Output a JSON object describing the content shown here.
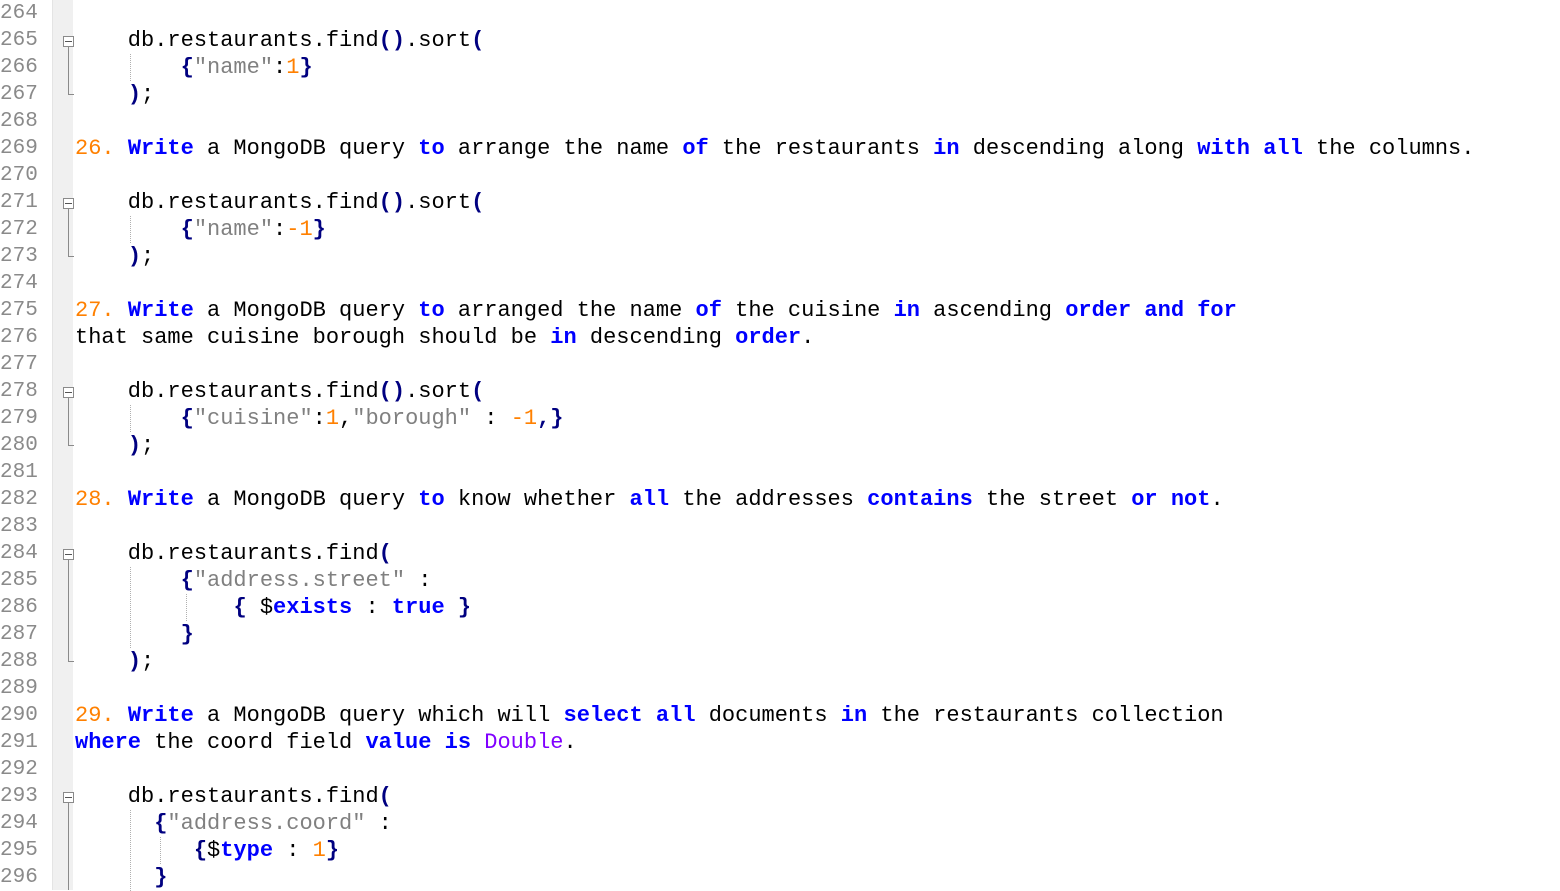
{
  "editor": {
    "line_numbers": [
      "264",
      "265",
      "266",
      "267",
      "268",
      "269",
      "270",
      "271",
      "272",
      "273",
      "274",
      "275",
      "276",
      "277",
      "278",
      "279",
      "280",
      "281",
      "282",
      "283",
      "284",
      "285",
      "286",
      "287",
      "288",
      "289",
      "290",
      "291",
      "292",
      "293",
      "294",
      "295",
      "296"
    ],
    "lines": [
      [],
      [
        {
          "t": "    db.restaurants.find",
          "c": "txt"
        },
        {
          "t": "()",
          "c": "op"
        },
        {
          "t": ".sort",
          "c": "txt"
        },
        {
          "t": "(",
          "c": "op"
        }
      ],
      [
        {
          "t": "        ",
          "c": "txt"
        },
        {
          "t": "{",
          "c": "op"
        },
        {
          "t": "\"name\"",
          "c": "str"
        },
        {
          "t": ":",
          "c": "txt"
        },
        {
          "t": "1",
          "c": "num"
        },
        {
          "t": "}",
          "c": "op"
        }
      ],
      [
        {
          "t": "    ",
          "c": "txt"
        },
        {
          "t": ")",
          "c": "op"
        },
        {
          "t": ";",
          "c": "txt"
        }
      ],
      [],
      [
        {
          "t": "26.",
          "c": "num"
        },
        {
          "t": " ",
          "c": "txt"
        },
        {
          "t": "Write",
          "c": "kw"
        },
        {
          "t": " a MongoDB query ",
          "c": "txt"
        },
        {
          "t": "to",
          "c": "kw"
        },
        {
          "t": " arrange the name ",
          "c": "txt"
        },
        {
          "t": "of",
          "c": "kw"
        },
        {
          "t": " the restaurants ",
          "c": "txt"
        },
        {
          "t": "in",
          "c": "kw"
        },
        {
          "t": " descending along ",
          "c": "txt"
        },
        {
          "t": "with",
          "c": "kw"
        },
        {
          "t": " ",
          "c": "txt"
        },
        {
          "t": "all",
          "c": "kw"
        },
        {
          "t": " the columns.",
          "c": "txt"
        }
      ],
      [],
      [
        {
          "t": "    db.restaurants.find",
          "c": "txt"
        },
        {
          "t": "()",
          "c": "op"
        },
        {
          "t": ".sort",
          "c": "txt"
        },
        {
          "t": "(",
          "c": "op"
        }
      ],
      [
        {
          "t": "        ",
          "c": "txt"
        },
        {
          "t": "{",
          "c": "op"
        },
        {
          "t": "\"name\"",
          "c": "str"
        },
        {
          "t": ":",
          "c": "txt"
        },
        {
          "t": "-1",
          "c": "num"
        },
        {
          "t": "}",
          "c": "op"
        }
      ],
      [
        {
          "t": "    ",
          "c": "txt"
        },
        {
          "t": ")",
          "c": "op"
        },
        {
          "t": ";",
          "c": "txt"
        }
      ],
      [],
      [
        {
          "t": "27.",
          "c": "num"
        },
        {
          "t": " ",
          "c": "txt"
        },
        {
          "t": "Write",
          "c": "kw"
        },
        {
          "t": " a MongoDB query ",
          "c": "txt"
        },
        {
          "t": "to",
          "c": "kw"
        },
        {
          "t": " arranged the name ",
          "c": "txt"
        },
        {
          "t": "of",
          "c": "kw"
        },
        {
          "t": " the cuisine ",
          "c": "txt"
        },
        {
          "t": "in",
          "c": "kw"
        },
        {
          "t": " ascending ",
          "c": "txt"
        },
        {
          "t": "order",
          "c": "kw"
        },
        {
          "t": " ",
          "c": "txt"
        },
        {
          "t": "and",
          "c": "kw"
        },
        {
          "t": " ",
          "c": "txt"
        },
        {
          "t": "for",
          "c": "kw"
        }
      ],
      [
        {
          "t": "that same cuisine borough should be ",
          "c": "txt"
        },
        {
          "t": "in",
          "c": "kw"
        },
        {
          "t": " descending ",
          "c": "txt"
        },
        {
          "t": "order",
          "c": "kw"
        },
        {
          "t": ".",
          "c": "txt"
        }
      ],
      [],
      [
        {
          "t": "    db.restaurants.find",
          "c": "txt"
        },
        {
          "t": "()",
          "c": "op"
        },
        {
          "t": ".sort",
          "c": "txt"
        },
        {
          "t": "(",
          "c": "op"
        }
      ],
      [
        {
          "t": "        ",
          "c": "txt"
        },
        {
          "t": "{",
          "c": "op"
        },
        {
          "t": "\"cuisine\"",
          "c": "str"
        },
        {
          "t": ":",
          "c": "txt"
        },
        {
          "t": "1",
          "c": "num"
        },
        {
          "t": ",",
          "c": "txt"
        },
        {
          "t": "\"borough\"",
          "c": "str"
        },
        {
          "t": " : ",
          "c": "txt"
        },
        {
          "t": "-1",
          "c": "num"
        },
        {
          "t": ",}",
          "c": "op"
        }
      ],
      [
        {
          "t": "    ",
          "c": "txt"
        },
        {
          "t": ")",
          "c": "op"
        },
        {
          "t": ";",
          "c": "txt"
        }
      ],
      [],
      [
        {
          "t": "28.",
          "c": "num"
        },
        {
          "t": " ",
          "c": "txt"
        },
        {
          "t": "Write",
          "c": "kw"
        },
        {
          "t": " a MongoDB query ",
          "c": "txt"
        },
        {
          "t": "to",
          "c": "kw"
        },
        {
          "t": " know whether ",
          "c": "txt"
        },
        {
          "t": "all",
          "c": "kw"
        },
        {
          "t": " the addresses ",
          "c": "txt"
        },
        {
          "t": "contains",
          "c": "kw"
        },
        {
          "t": " the street ",
          "c": "txt"
        },
        {
          "t": "or",
          "c": "kw"
        },
        {
          "t": " ",
          "c": "txt"
        },
        {
          "t": "not",
          "c": "kw"
        },
        {
          "t": ".",
          "c": "txt"
        }
      ],
      [],
      [
        {
          "t": "    db.restaurants.find",
          "c": "txt"
        },
        {
          "t": "(",
          "c": "op"
        }
      ],
      [
        {
          "t": "        ",
          "c": "txt"
        },
        {
          "t": "{",
          "c": "op"
        },
        {
          "t": "\"address.street\"",
          "c": "str"
        },
        {
          "t": " :",
          "c": "txt"
        }
      ],
      [
        {
          "t": "            ",
          "c": "txt"
        },
        {
          "t": "{",
          "c": "op"
        },
        {
          "t": " $",
          "c": "txt"
        },
        {
          "t": "exists",
          "c": "kw"
        },
        {
          "t": " : ",
          "c": "txt"
        },
        {
          "t": "true",
          "c": "kw"
        },
        {
          "t": " ",
          "c": "txt"
        },
        {
          "t": "}",
          "c": "op"
        }
      ],
      [
        {
          "t": "        ",
          "c": "txt"
        },
        {
          "t": "}",
          "c": "op"
        }
      ],
      [
        {
          "t": "    ",
          "c": "txt"
        },
        {
          "t": ")",
          "c": "op"
        },
        {
          "t": ";",
          "c": "txt"
        }
      ],
      [],
      [
        {
          "t": "29.",
          "c": "num"
        },
        {
          "t": " ",
          "c": "txt"
        },
        {
          "t": "Write",
          "c": "kw"
        },
        {
          "t": " a MongoDB query which will ",
          "c": "txt"
        },
        {
          "t": "select",
          "c": "kw"
        },
        {
          "t": " ",
          "c": "txt"
        },
        {
          "t": "all",
          "c": "kw"
        },
        {
          "t": " documents ",
          "c": "txt"
        },
        {
          "t": "in",
          "c": "kw"
        },
        {
          "t": " the restaurants collection",
          "c": "txt"
        }
      ],
      [
        {
          "t": "where",
          "c": "kw"
        },
        {
          "t": " the coord field ",
          "c": "txt"
        },
        {
          "t": "value",
          "c": "kw"
        },
        {
          "t": " ",
          "c": "txt"
        },
        {
          "t": "is",
          "c": "kw"
        },
        {
          "t": " ",
          "c": "txt"
        },
        {
          "t": "Double",
          "c": "typ"
        },
        {
          "t": ".",
          "c": "txt"
        }
      ],
      [],
      [
        {
          "t": "    db.restaurants.find",
          "c": "txt"
        },
        {
          "t": "(",
          "c": "op"
        }
      ],
      [
        {
          "t": "      ",
          "c": "txt"
        },
        {
          "t": "{",
          "c": "op"
        },
        {
          "t": "\"address.coord\"",
          "c": "str"
        },
        {
          "t": " :",
          "c": "txt"
        }
      ],
      [
        {
          "t": "         ",
          "c": "txt"
        },
        {
          "t": "{",
          "c": "op"
        },
        {
          "t": "$",
          "c": "txt"
        },
        {
          "t": "type",
          "c": "kw"
        },
        {
          "t": " : ",
          "c": "txt"
        },
        {
          "t": "1",
          "c": "num"
        },
        {
          "t": "}",
          "c": "op"
        }
      ],
      [
        {
          "t": "      ",
          "c": "txt"
        },
        {
          "t": "}",
          "c": "op"
        }
      ]
    ]
  }
}
